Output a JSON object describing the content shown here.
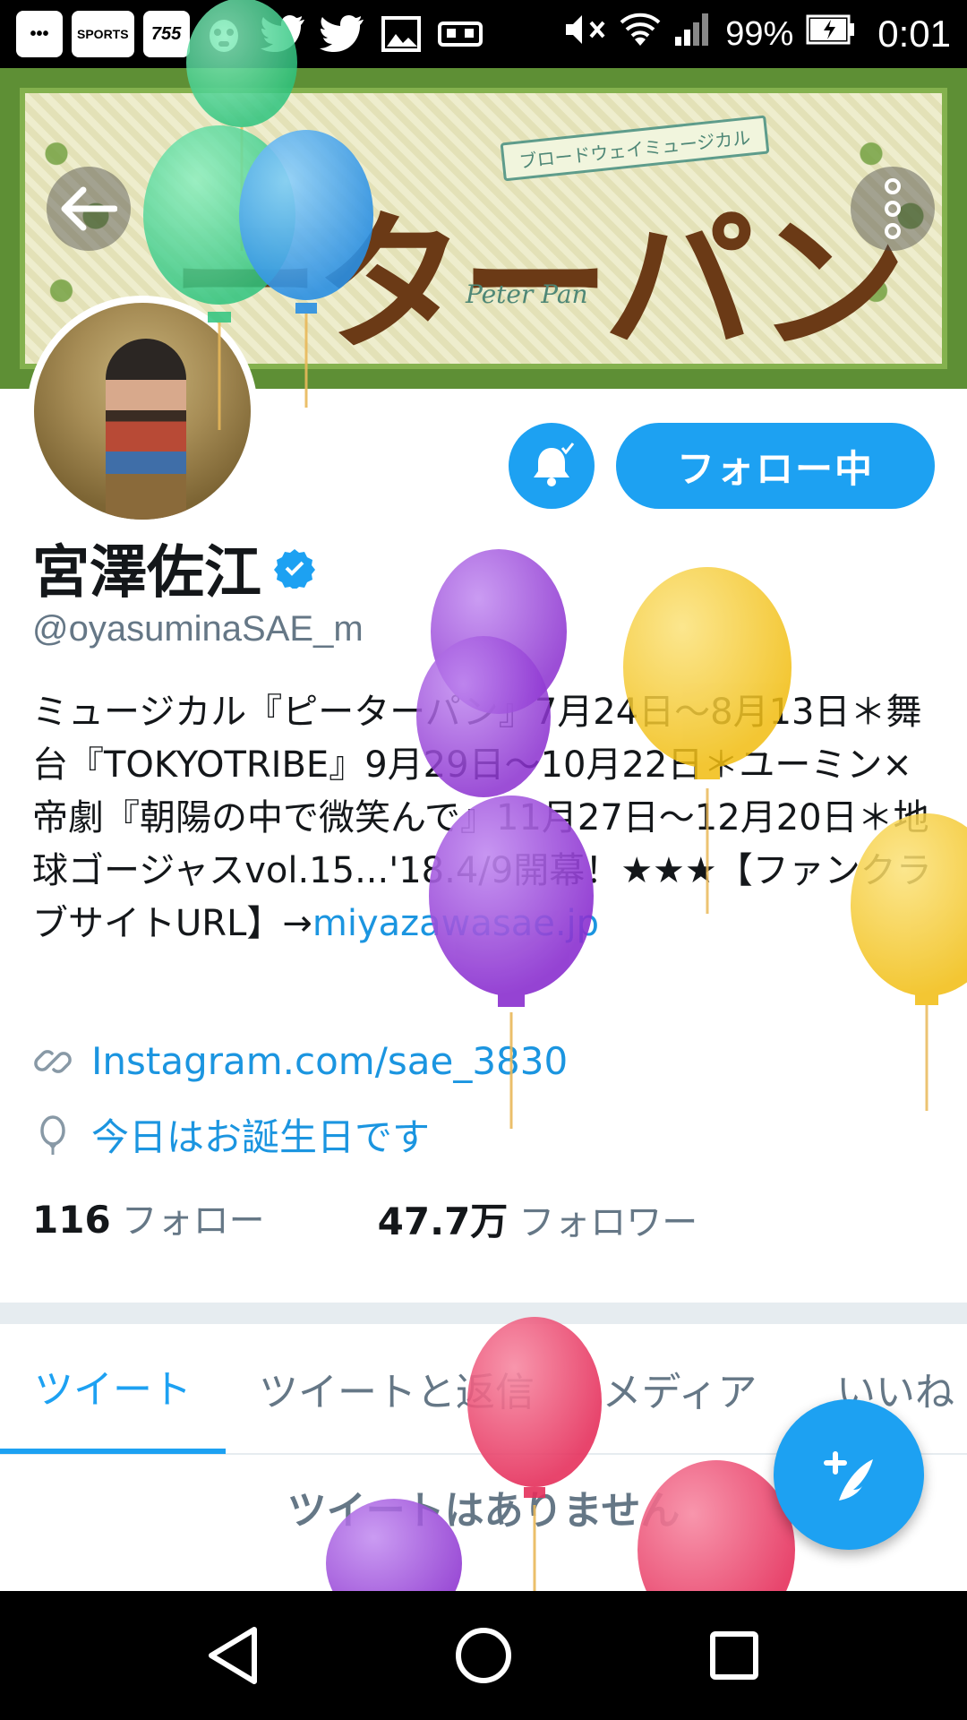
{
  "status_bar": {
    "app_icons": [
      "•••",
      "SPORTS",
      "755"
    ],
    "battery": "99%",
    "time": "0:01"
  },
  "banner": {
    "title": "ーターパン",
    "ribbon": "ブロードウェイミュージカル",
    "subtitle": "Peter Pan"
  },
  "profile": {
    "name": "宮澤佐江",
    "handle": "@oyasuminaSAE_m",
    "bio_text": "ミュージカル『ピーターパン』7月24日〜8月13日＊舞台『TOKYOTRIBE』9月29日〜10月22日＊ユーミン×帝劇『朝陽の中で微笑んで』11月27日〜12月20日＊地球ゴージャスvol.15...'18.4/9開幕！★★★【ファンクラブサイトURL】→",
    "bio_link": "miyazawasae.jp",
    "website": "Instagram.com/sae_3830",
    "birthday": "今日はお誕生日です",
    "following_count": "116",
    "following_label": "フォロー",
    "followers_count": "47.7万",
    "followers_label": "フォロワー"
  },
  "buttons": {
    "follow": "フォロー中"
  },
  "tabs": [
    {
      "label": "ツイート",
      "active": true
    },
    {
      "label": "ツイートと返信",
      "active": false
    },
    {
      "label": "メディア",
      "active": false
    },
    {
      "label": "いいね",
      "active": false
    }
  ],
  "empty_state": "ツイートはありません",
  "colors": {
    "accent": "#1da1f2",
    "balloon_purple": "#9b3fd8",
    "balloon_yellow": "#f4c51a",
    "balloon_red": "#e83f68",
    "balloon_green": "#3fcf8e",
    "balloon_blue": "#3aa0ee"
  },
  "icons": {
    "back": "arrow-left-icon",
    "more": "more-vertical-icon",
    "bell": "bell-icon",
    "verified": "verified-badge-icon",
    "link": "link-icon",
    "birthday": "balloon-icon",
    "compose": "compose-tweet-icon"
  }
}
